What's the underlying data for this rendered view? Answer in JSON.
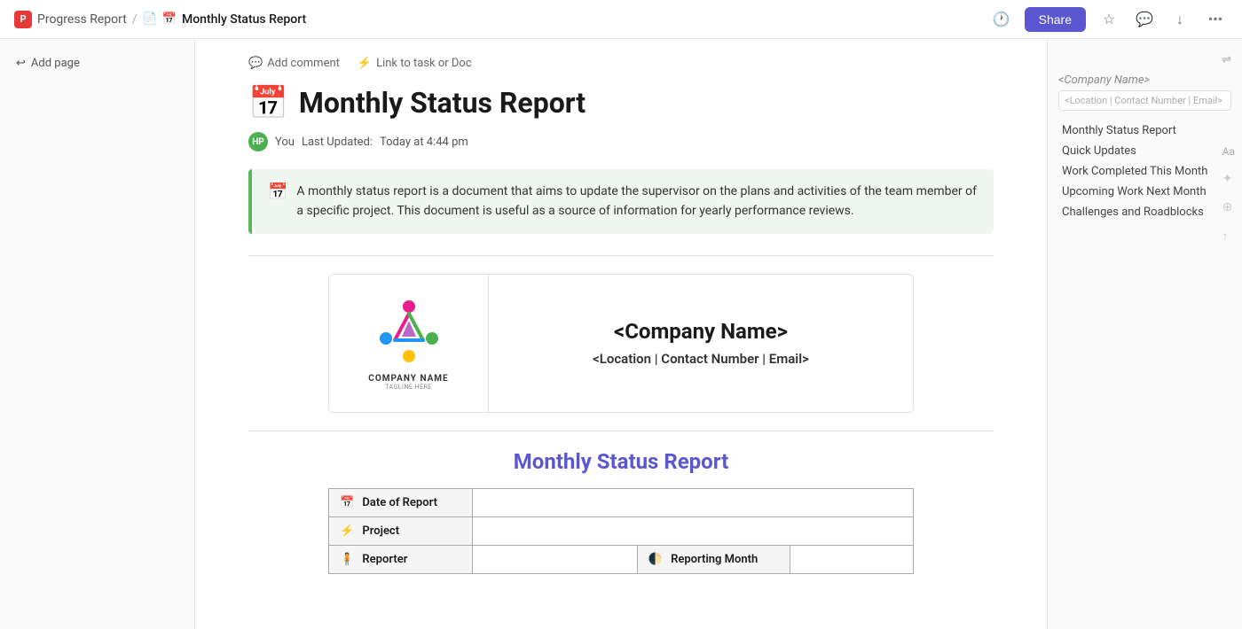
{
  "topbar": {
    "app_name": "Progress Report",
    "app_icon": "P",
    "breadcrumb_sep": "/",
    "doc_icon": "📄",
    "calendar_icon": "📅",
    "doc_title": "Monthly Status Report",
    "share_label": "Share"
  },
  "sidebar_left": {
    "add_page_label": "Add page"
  },
  "action_bar": {
    "comment_label": "Add comment",
    "link_label": "Link to task or Doc"
  },
  "document": {
    "title_icon": "📅",
    "title": "Monthly Status Report",
    "author": "You",
    "last_updated_label": "Last Updated:",
    "last_updated_value": "Today at 4:44 pm",
    "callout_icon": "📅",
    "callout_text": "A monthly status report is a document that aims to update the supervisor on the plans and activities of the team member of a specific project. This document is useful as a source of information for yearly performance reviews."
  },
  "company_card": {
    "logo_label": "COMPANY NAME",
    "logo_tagline": "TAGLINE HERE",
    "name": "<Company Name>",
    "contact": "<Location | Contact Number | Email>"
  },
  "report_section": {
    "title": "Monthly Status Report",
    "table_rows": [
      {
        "label_icon": "📅",
        "label": "Date of Report",
        "value": "",
        "has_right": false
      },
      {
        "label_icon": "⚡",
        "label": "Project",
        "value": "",
        "has_right": false
      },
      {
        "label_icon": "🧍",
        "label": "Reporter",
        "value": "",
        "has_right": true,
        "right_label_icon": "🌓",
        "right_label": "Reporting Month",
        "right_value": ""
      }
    ]
  },
  "right_sidebar": {
    "company_placeholder": "<Company Name>",
    "location_placeholder": "<Location | Contact Number | Email>",
    "nav_items": [
      {
        "label": "Monthly Status Report",
        "active": false
      },
      {
        "label": "Quick Updates",
        "active": false
      },
      {
        "label": "Work Completed This Month",
        "active": false
      },
      {
        "label": "Upcoming Work Next Month",
        "active": false
      },
      {
        "label": "Challenges and Roadblocks",
        "active": false
      }
    ]
  }
}
